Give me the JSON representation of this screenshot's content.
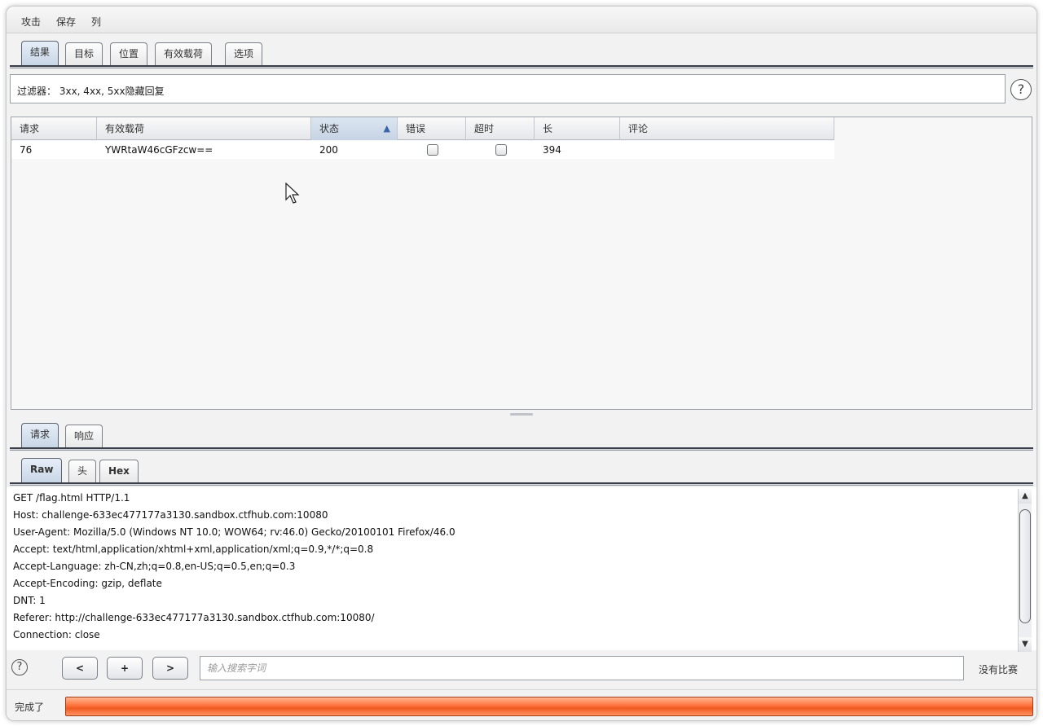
{
  "menu": {
    "attack": "攻击",
    "save": "保存",
    "columns": "列"
  },
  "main_tabs": [
    {
      "label": "结果",
      "active": true
    },
    {
      "label": "目标",
      "active": false
    },
    {
      "label": "位置",
      "active": false
    },
    {
      "label": "有效载荷",
      "active": false
    },
    {
      "label": "选项",
      "active": false
    }
  ],
  "filter": {
    "label": "过滤器：",
    "text": "3xx, 4xx, 5xx隐藏回复"
  },
  "help_icon_glyph": "?",
  "results_table": {
    "columns": [
      "请求",
      "有效载荷",
      "状态",
      "错误",
      "超时",
      "长",
      "评论"
    ],
    "sorted_column": "状态",
    "sort_direction": "ascending",
    "rows": [
      {
        "request": "76",
        "payload": "YWRtaW46cGFzcw==",
        "status": "200",
        "error": false,
        "timeout": false,
        "length": "394",
        "comment": ""
      }
    ]
  },
  "detail_tabs": [
    {
      "label": "请求",
      "active": true
    },
    {
      "label": "响应",
      "active": false
    }
  ],
  "view_tabs": [
    {
      "label": "Raw",
      "active": true
    },
    {
      "label": "头",
      "active": false
    },
    {
      "label": "Hex",
      "active": false
    }
  ],
  "raw_request_lines": [
    "GET /flag.html HTTP/1.1",
    "Host: challenge-633ec477177a3130.sandbox.ctfhub.com:10080",
    "User-Agent: Mozilla/5.0 (Windows NT 10.0; WOW64; rv:46.0) Gecko/20100101 Firefox/46.0",
    "Accept: text/html,application/xhtml+xml,application/xml;q=0.9,*/*;q=0.8",
    "Accept-Language: zh-CN,zh;q=0.8,en-US;q=0.5,en;q=0.3",
    "Accept-Encoding: gzip, deflate",
    "DNT: 1",
    "Referer: http://challenge-633ec477177a3130.sandbox.ctfhub.com:10080/",
    "Connection: close"
  ],
  "search": {
    "prev": "<",
    "add": "+",
    "next": ">",
    "placeholder": "输入搜索字词",
    "match_status": "没有比赛"
  },
  "status": {
    "text": "完成了",
    "progress": 1.0,
    "progress_color": "#f26b35"
  }
}
